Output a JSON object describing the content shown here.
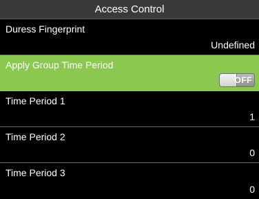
{
  "header": {
    "title": "Access Control"
  },
  "rows": [
    {
      "label": "Duress Fingerprint",
      "value": "Undefined"
    },
    {
      "label": "Apply Group Time Period",
      "toggle_text": "OFF"
    },
    {
      "label": "Time Period 1",
      "value": "1"
    },
    {
      "label": "Time Period 2",
      "value": "0"
    },
    {
      "label": "Time Period 3",
      "value": "0"
    }
  ],
  "colors": {
    "selected_row": "#8ac850",
    "title_bar": "#3a3a3a",
    "background": "#000000"
  }
}
